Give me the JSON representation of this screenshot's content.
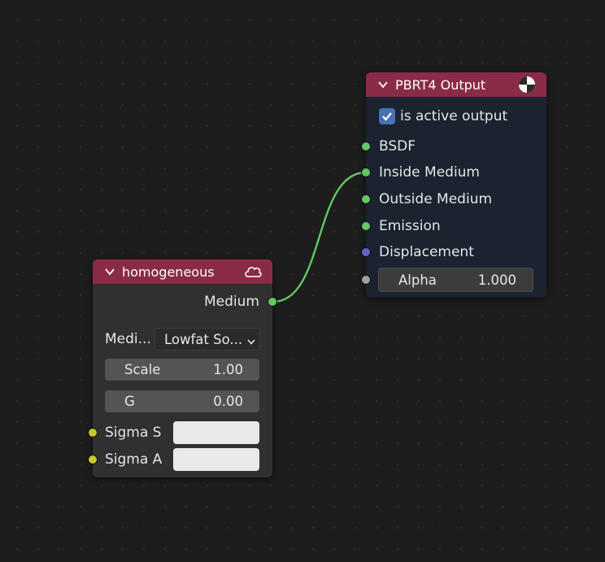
{
  "nodes": {
    "output": {
      "title": "PBRT4 Output",
      "checkbox_label": "is active output",
      "checkbox_checked": true,
      "icon": "material-sphere-icon",
      "inputs": [
        {
          "label": "BSDF",
          "socket_color": "#63c763"
        },
        {
          "label": "Inside Medium",
          "socket_color": "#63c763"
        },
        {
          "label": "Outside Medium",
          "socket_color": "#63c763"
        },
        {
          "label": "Emission",
          "socket_color": "#63c763"
        },
        {
          "label": "Displacement",
          "socket_color": "#6363c7"
        }
      ],
      "alpha": {
        "label": "Alpha",
        "value": "1.000",
        "socket_color": "#a1a1a1"
      }
    },
    "homogeneous": {
      "title": "homogeneous",
      "icon": "volume-cloud-icon",
      "output_label": "Medium",
      "output_socket_color": "#63c763",
      "medium_label": "Medi...",
      "medium_value": "Lowfat So...",
      "scale": {
        "label": "Scale",
        "value": "1.00"
      },
      "g": {
        "label": "G",
        "value": "0.00"
      },
      "sigma_s": {
        "label": "Sigma S",
        "socket_color": "#c7c729",
        "value_color": "#e9e9e9"
      },
      "sigma_a": {
        "label": "Sigma A",
        "socket_color": "#c7c729",
        "value_color": "#e9e9e9"
      }
    }
  },
  "colors": {
    "header": "#8a2b47",
    "link": "#63c763",
    "accent": "#4772b3"
  }
}
